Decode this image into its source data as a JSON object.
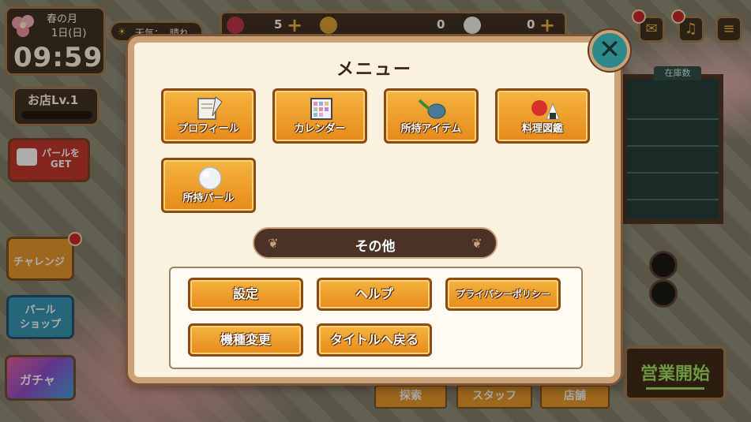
{
  "hud": {
    "season": "春の月",
    "date": "1日(日)",
    "time": "09:59",
    "weather_label": "天気：",
    "weather_value": "晴れ",
    "shop_level": "お店Lv.1",
    "shop_level_progress": 0.0,
    "energy": "5",
    "coins": "0",
    "pearls": "0",
    "stock_label": "在庫数"
  },
  "left_buttons": {
    "pearl_get": "パールを\nGET",
    "challenge": "チャレンジ",
    "pearl_shop_line1": "パール",
    "pearl_shop_line2": "ショップ",
    "gacha": "ガチャ"
  },
  "bottom_tabs": [
    "探索",
    "スタッフ",
    "店舗"
  ],
  "open_shop": "営業開始",
  "menu": {
    "title": "メニュー",
    "tiles": [
      {
        "label": "プロフィール",
        "icon": "profile-scroll-icon"
      },
      {
        "label": "カレンダー",
        "icon": "calendar-icon"
      },
      {
        "label": "所持アイテム",
        "icon": "item-teapot-icon"
      },
      {
        "label": "料理図鑑",
        "icon": "food-tomato-onigiri-icon"
      },
      {
        "label": "所持パール",
        "icon": "pearl-icon"
      }
    ],
    "other_heading": "その他",
    "other_buttons": [
      {
        "label": "設定"
      },
      {
        "label": "ヘルプ"
      },
      {
        "label": "プライバシーポリシー"
      },
      {
        "label": "機種変更"
      },
      {
        "label": "タイトルへ戻る"
      }
    ],
    "close_symbol": "✕"
  },
  "colors": {
    "dialog_bg": "#fbf1df",
    "dialog_border": "#c9a277",
    "tile_orange": "#f0a030",
    "close_teal": "#2e8a8a",
    "open_shop_green": "#9fe060"
  }
}
